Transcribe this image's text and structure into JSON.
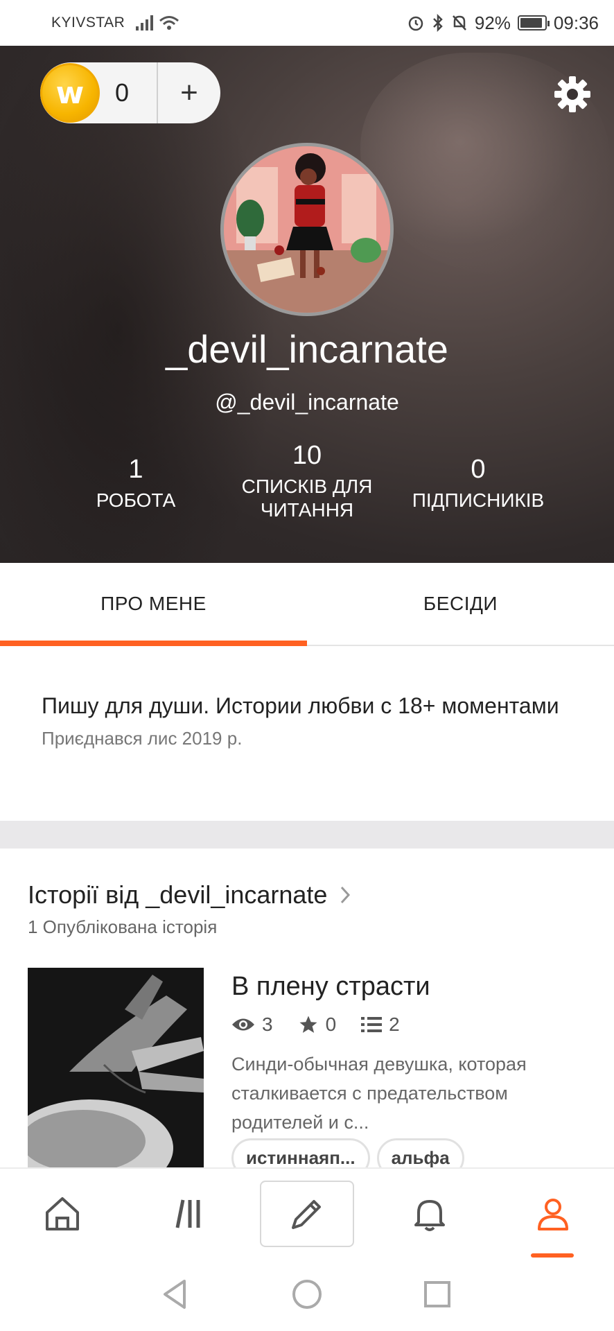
{
  "status_bar": {
    "carrier": "KYIVSTAR",
    "battery_percent": "92%",
    "time": "09:36",
    "battery_level": 0.92
  },
  "wallet": {
    "coin_letter": "w",
    "coins": "0",
    "add_label": "+"
  },
  "profile": {
    "display_name": "_devil_incarnate",
    "handle": "@_devil_incarnate",
    "stats": [
      {
        "value": "1",
        "label": "РОБОТА"
      },
      {
        "value": "10",
        "label": "СПИСКІВ ДЛЯ ЧИТАННЯ"
      },
      {
        "value": "0",
        "label": "ПІДПИСНИКІВ"
      }
    ]
  },
  "tabs": [
    {
      "label": "ПРО МЕНЕ",
      "active": true
    },
    {
      "label": "БЕСІДИ",
      "active": false
    }
  ],
  "about": {
    "bio": "Пишу для души. Истории любви с 18+ моментами",
    "joined": "Приєднався лис 2019 р."
  },
  "stories_section": {
    "title": "Історії від _devil_incarnate",
    "count_label": "1 Опублікована історія",
    "stories": [
      {
        "title": "В плену страсти",
        "reads": "3",
        "votes": "0",
        "parts": "2",
        "description": "Синди-обычная девушка, которая сталкивается с предательством родителей и с...",
        "tags": [
          "истиннаяп...",
          "альфа"
        ]
      }
    ]
  },
  "bottom_nav": [
    {
      "name": "home-icon"
    },
    {
      "name": "library-icon"
    },
    {
      "name": "write-icon"
    },
    {
      "name": "notifications-icon"
    },
    {
      "name": "profile-icon",
      "active": true
    }
  ],
  "colors": {
    "accent": "#ff6122",
    "coin": "#f7b500"
  }
}
